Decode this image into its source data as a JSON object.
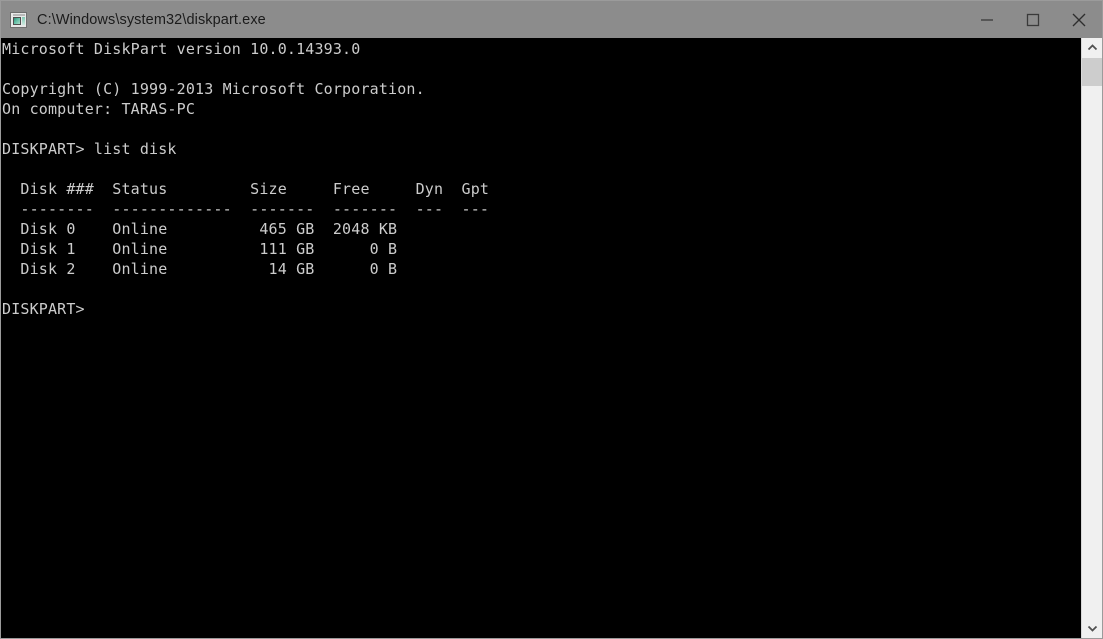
{
  "window": {
    "title": "C:\\Windows\\system32\\diskpart.exe",
    "icon": "console-app-icon",
    "titlebar_color": "#8c8c8c",
    "background_color": "#000000",
    "text_color": "#cccccc",
    "controls": {
      "minimize_label": "Minimize",
      "maximize_label": "Maximize",
      "close_label": "Close"
    }
  },
  "console": {
    "lines": [
      "Microsoft DiskPart version 10.0.14393.0",
      "",
      "Copyright (C) 1999-2013 Microsoft Corporation.",
      "On computer: TARAS-PC",
      "",
      "DISKPART> list disk",
      "",
      "  Disk ###  Status         Size     Free     Dyn  Gpt",
      "  --------  -------------  -------  -------  ---  ---",
      "  Disk 0    Online          465 GB  2048 KB",
      "  Disk 1    Online          111 GB      0 B",
      "  Disk 2    Online           14 GB      0 B",
      "",
      "DISKPART>"
    ],
    "version_line": "Microsoft DiskPart version 10.0.14393.0",
    "copyright_line": "Copyright (C) 1999-2013 Microsoft Corporation.",
    "computer_line": "On computer: TARAS-PC",
    "prompt": "DISKPART>",
    "command": "list disk",
    "table": {
      "headers": [
        "Disk ###",
        "Status",
        "Size",
        "Free",
        "Dyn",
        "Gpt"
      ],
      "separators": [
        "--------",
        "-------------",
        "-------",
        "-------",
        "---",
        "---"
      ],
      "rows": [
        {
          "disk": "Disk 0",
          "status": "Online",
          "size": "465 GB",
          "free": "2048 KB",
          "dyn": "",
          "gpt": ""
        },
        {
          "disk": "Disk 1",
          "status": "Online",
          "size": "111 GB",
          "free": "0 B",
          "dyn": "",
          "gpt": ""
        },
        {
          "disk": "Disk 2",
          "status": "Online",
          "size": "14 GB",
          "free": "0 B",
          "dyn": "",
          "gpt": ""
        }
      ]
    }
  },
  "scrollbar": {
    "up_arrow": "chevron-up-icon",
    "down_arrow": "chevron-down-icon",
    "thumb_position_percent": 0,
    "thumb_size_percent": 5
  }
}
